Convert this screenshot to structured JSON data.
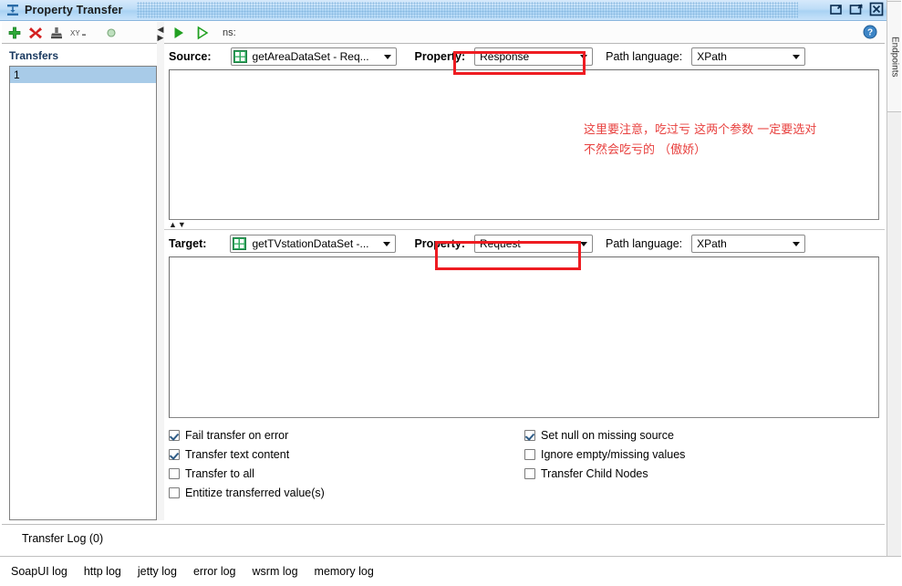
{
  "window": {
    "title": "Property Transfer",
    "title_icon": "property-transfer-icon",
    "buttons": [
      {
        "name": "restore-down-button",
        "glyph": "restore"
      },
      {
        "name": "maximize-button",
        "glyph": "maximize"
      },
      {
        "name": "close-button",
        "glyph": "close"
      }
    ]
  },
  "left_toolbar": {
    "icons": [
      {
        "name": "add-transfer-icon",
        "glyph": "plus"
      },
      {
        "name": "remove-transfer-icon",
        "glyph": "cross"
      },
      {
        "name": "declare-namespace-icon",
        "glyph": "stamp"
      },
      {
        "name": "xy-icon",
        "glyph": "XY"
      },
      {
        "name": "status-indicator-icon",
        "glyph": "dot"
      }
    ]
  },
  "sidebar": {
    "header": "Transfers",
    "items": [
      {
        "label": "1",
        "selected": true
      }
    ]
  },
  "main_toolbar": {
    "run_button": "run-transfer-icon",
    "run_all_button": "run-all-transfers-icon",
    "ns_label": "ns:",
    "help_button": "help-icon"
  },
  "source": {
    "label": "Source:",
    "step_value": "getAreaDataSet - Req...",
    "step_icon": "xml-step-icon",
    "property_label": "Property:",
    "property_value": "Response",
    "path_language_label": "Path language:",
    "path_language_value": "XPath",
    "editor_value": ""
  },
  "target": {
    "label": "Target:",
    "step_value": "getTVstationDataSet -...",
    "step_icon": "xml-step-icon",
    "property_label": "Property:",
    "property_value": "Request",
    "path_language_label": "Path language:",
    "path_language_value": "XPath",
    "editor_value": ""
  },
  "options": {
    "left_column": [
      {
        "label": "Fail transfer on error",
        "checked": true
      },
      {
        "label": "Transfer text content",
        "checked": true
      },
      {
        "label": "Transfer to all",
        "checked": false
      },
      {
        "label": "Entitize transferred value(s)",
        "checked": false
      }
    ],
    "right_column": [
      {
        "label": "Set null on missing source",
        "checked": true
      },
      {
        "label": "Ignore empty/missing values",
        "checked": false
      },
      {
        "label": "Transfer Child Nodes",
        "checked": false
      }
    ]
  },
  "transfer_log": {
    "label": "Transfer Log (0)"
  },
  "log_tabs": [
    {
      "label": "SoapUI log"
    },
    {
      "label": "http log"
    },
    {
      "label": "jetty log"
    },
    {
      "label": "error log"
    },
    {
      "label": "wsrm log"
    },
    {
      "label": "memory log"
    }
  ],
  "right_tab": {
    "label": "Endpoints"
  },
  "annotations": {
    "color": "#ee1c22",
    "text_color": "#e8413f",
    "note_line1": "这里要注意，吃过亏 这两个参数 一定要选对",
    "note_line2": "不然会吃亏的 （傲娇）",
    "highlight_source_property": "Response",
    "highlight_target_property": "Request"
  },
  "colors": {
    "accent": "#a8cbe8",
    "titlebar": "#bdddf7",
    "header_text": "#17375e",
    "annotation_red": "#ee1c22",
    "green": "#2aa22a"
  }
}
